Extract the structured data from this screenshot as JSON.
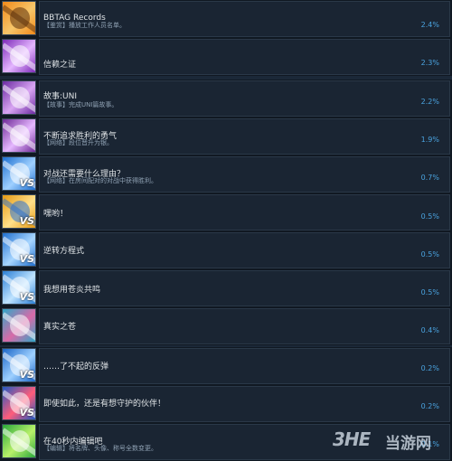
{
  "achievements": [
    {
      "name": "BBTAG Records",
      "desc": "【鉴赏】播放工作人员名单。",
      "percent": "2.4%",
      "icon": "achievement-icon-records",
      "colors": [
        "#f28a1a",
        "#f6c66a",
        "#5a2e0a"
      ]
    },
    {
      "name": "信赖之证",
      "desc": "",
      "percent": "2.3%",
      "icon": "achievement-icon-trust",
      "colors": [
        "#7d2bb8",
        "#e4b6ff",
        "#ffffff"
      ]
    },
    {
      "name": "故事:UNI",
      "desc": "【故事】完成UNI篇故事。",
      "percent": "2.2%",
      "icon": "achievement-icon-story-uni",
      "colors": [
        "#6b2aa2",
        "#d8a5f2",
        "#ffffff"
      ]
    },
    {
      "name": "不断追求胜利的勇气",
      "desc": "【网络】段位晋升为银。",
      "percent": "1.9%",
      "icon": "achievement-icon-courage",
      "colors": [
        "#6e2a96",
        "#e6b8ff",
        "#ffffff"
      ]
    },
    {
      "name": "对战还需要什么理由？",
      "desc": "【网络】在房间配对的对战中获得胜利。",
      "percent": "0.7%",
      "icon": "achievement-icon-battle-vs",
      "colors": [
        "#1e6fd0",
        "#9fd0ff",
        "#ffffff"
      ]
    },
    {
      "name": "嘿哟！",
      "desc": "",
      "percent": "0.5%",
      "icon": "achievement-icon-heyo-vs",
      "colors": [
        "#e79a12",
        "#ffe08a",
        "#2a6fd0"
      ]
    },
    {
      "name": "逆转方程式",
      "desc": "",
      "percent": "0.5%",
      "icon": "achievement-icon-reversal-vs",
      "colors": [
        "#1f6fcf",
        "#a8d6ff",
        "#ffffff"
      ]
    },
    {
      "name": "我想用苍炎共鸣",
      "desc": "",
      "percent": "0.5%",
      "icon": "achievement-icon-azure-flame",
      "colors": [
        "#2a7fd6",
        "#bfe3ff",
        "#ffffff"
      ]
    },
    {
      "name": "真实之苍",
      "desc": "",
      "percent": "0.4%",
      "icon": "achievement-icon-true-azure",
      "colors": [
        "#2fa7c8",
        "#d86aa8",
        "#ffffff"
      ]
    },
    {
      "name": "……了不起的反弹",
      "desc": "",
      "percent": "0.2%",
      "icon": "achievement-icon-rebound-vs",
      "colors": [
        "#1c66c8",
        "#9ed0ff",
        "#ffffff"
      ]
    },
    {
      "name": "即使如此，还是有想守护的伙伴！",
      "desc": "",
      "percent": "0.2%",
      "icon": "achievement-icon-partners-vs",
      "colors": [
        "#2259c2",
        "#ff5d7a",
        "#ffffff"
      ]
    },
    {
      "name": "在40秒内编辑吧",
      "desc": "【编辑】将名牌、头像、称号全数变更。",
      "percent": "0.1%",
      "icon": "achievement-icon-edit",
      "colors": [
        "#2aa83a",
        "#b8f06a",
        "#ffffff"
      ]
    }
  ],
  "watermark": {
    "logo": "3HE",
    "text": "当游网"
  }
}
